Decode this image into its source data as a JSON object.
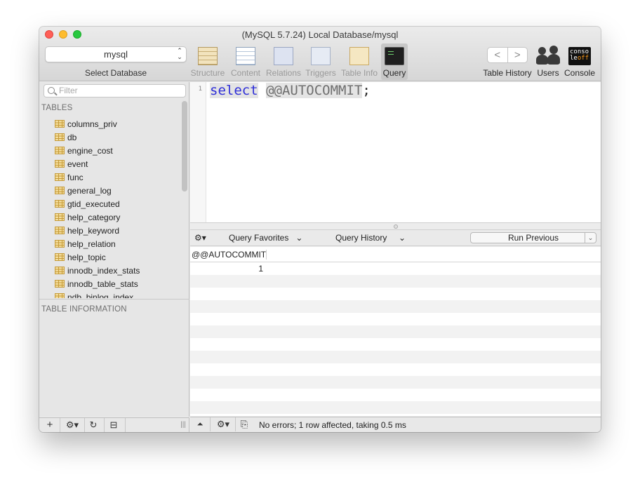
{
  "window": {
    "title": "(MySQL 5.7.24) Local Database/mysql"
  },
  "database_selector": {
    "value": "mysql",
    "caption": "Select Database"
  },
  "toolbar": {
    "tabs": [
      {
        "label": "Structure",
        "icon": "structure-icon",
        "active": false
      },
      {
        "label": "Content",
        "icon": "content-icon",
        "active": false
      },
      {
        "label": "Relations",
        "icon": "relations-icon",
        "active": false
      },
      {
        "label": "Triggers",
        "icon": "triggers-icon",
        "active": false
      },
      {
        "label": "Table Info",
        "icon": "table-info-icon",
        "active": false
      },
      {
        "label": "Query",
        "icon": "query-icon",
        "active": true
      }
    ],
    "history_label": "Table History",
    "users_label": "Users",
    "console_label": "Console",
    "console_icon_text_1": "conso",
    "console_icon_text_2": "le",
    "console_icon_text_3": "off",
    "back_glyph": "<",
    "forward_glyph": ">"
  },
  "sidebar": {
    "filter_placeholder": "Filter",
    "tables_title": "TABLES",
    "tables": [
      "columns_priv",
      "db",
      "engine_cost",
      "event",
      "func",
      "general_log",
      "gtid_executed",
      "help_category",
      "help_keyword",
      "help_relation",
      "help_topic",
      "innodb_index_stats",
      "innodb_table_stats",
      "ndb_binlog_index"
    ],
    "info_title": "TABLE INFORMATION"
  },
  "editor": {
    "line_number": "1",
    "keyword": "select",
    "variable": "@@AUTOCOMMIT",
    "terminator": ";"
  },
  "query_bar": {
    "favorites_label": "Query Favorites",
    "history_label": "Query History",
    "run_previous_label": "Run Previous"
  },
  "results": {
    "columns": [
      "@@AUTOCOMMIT"
    ],
    "rows": [
      [
        "1"
      ]
    ]
  },
  "status": {
    "text": "No errors; 1 row affected, taking 0.5 ms"
  },
  "colors": {
    "keyword": "#2e2ed8",
    "active_tab_bg": "#c7c7c7"
  }
}
